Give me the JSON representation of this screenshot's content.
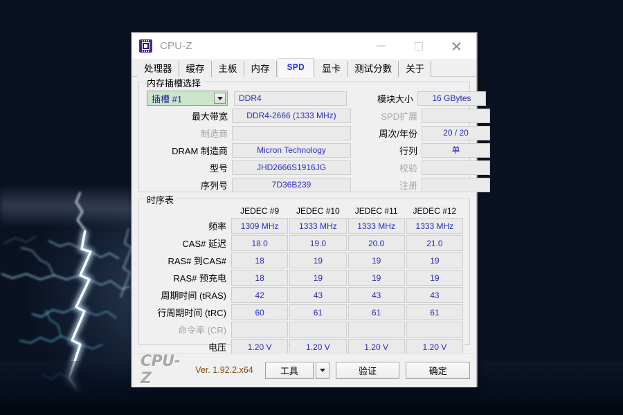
{
  "window": {
    "title": "CPU-Z",
    "icon": "cpu-chip-icon",
    "controls": {
      "minimize": "–",
      "maximize": "□",
      "close": "✕"
    }
  },
  "tabs": [
    {
      "label": "处理器",
      "active": false
    },
    {
      "label": "缓存",
      "active": false
    },
    {
      "label": "主板",
      "active": false
    },
    {
      "label": "内存",
      "active": false
    },
    {
      "label": "SPD",
      "active": true
    },
    {
      "label": "显卡",
      "active": false
    },
    {
      "label": "测试分數",
      "active": false
    },
    {
      "label": "关于",
      "active": false
    }
  ],
  "slot_group": {
    "legend": "内存插槽选择",
    "slot_selected": "插槽 #1",
    "module_type": "DDR4",
    "left_fields": [
      {
        "label": "最大带宽",
        "value": "DDR4-2666 (1333 MHz)",
        "dim": false
      },
      {
        "label": "制造商",
        "value": "",
        "dim": true
      },
      {
        "label": "DRAM 制造商",
        "value": "Micron Technology",
        "dim": false
      },
      {
        "label": "型号",
        "value": "JHD2666S1916JG",
        "dim": false
      },
      {
        "label": "序列号",
        "value": "7D36B239",
        "dim": false
      }
    ],
    "right_fields": [
      {
        "label": "模块大小",
        "value": "16 GBytes",
        "dim": false
      },
      {
        "label": "SPD扩展",
        "value": "",
        "dim": true
      },
      {
        "label": "周次/年份",
        "value": "20 / 20",
        "dim": false
      },
      {
        "label": "行列",
        "value": "单",
        "dim": false
      },
      {
        "label": "校验",
        "value": "",
        "dim": true
      },
      {
        "label": "注册",
        "value": "",
        "dim": true
      }
    ]
  },
  "timings_group": {
    "legend": "时序表",
    "columns": [
      "JEDEC #9",
      "JEDEC #10",
      "JEDEC #11",
      "JEDEC #12"
    ],
    "rows": [
      {
        "label": "频率",
        "dim": false,
        "values": [
          "1309 MHz",
          "1333 MHz",
          "1333 MHz",
          "1333 MHz"
        ]
      },
      {
        "label": "CAS# 延迟",
        "dim": false,
        "values": [
          "18.0",
          "19.0",
          "20.0",
          "21.0"
        ]
      },
      {
        "label": "RAS# 到CAS#",
        "dim": false,
        "values": [
          "18",
          "19",
          "19",
          "19"
        ]
      },
      {
        "label": "RAS# 预充电",
        "dim": false,
        "values": [
          "18",
          "19",
          "19",
          "19"
        ]
      },
      {
        "label": "周期时间 (tRAS)",
        "dim": false,
        "values": [
          "42",
          "43",
          "43",
          "43"
        ]
      },
      {
        "label": "行周期时间 (tRC)",
        "dim": false,
        "values": [
          "60",
          "61",
          "61",
          "61"
        ]
      },
      {
        "label": "命令率 (CR)",
        "dim": true,
        "values": [
          "",
          "",
          "",
          ""
        ]
      },
      {
        "label": "电压",
        "dim": false,
        "values": [
          "1.20 V",
          "1.20 V",
          "1.20 V",
          "1.20 V"
        ]
      }
    ]
  },
  "footer": {
    "brand": "CPU-Z",
    "version": "Ver. 1.92.2.x64",
    "tools_label": "工具",
    "tools_arrow": "▼",
    "validate_label": "验证",
    "ok_label": "确定"
  },
  "colors": {
    "value_text": "#2b2bbe",
    "accent_tab": "#2b32d6",
    "slot_bg": "#c9e7c8",
    "version_text": "#7a4a10",
    "window_bg": "#f0f0f0"
  }
}
